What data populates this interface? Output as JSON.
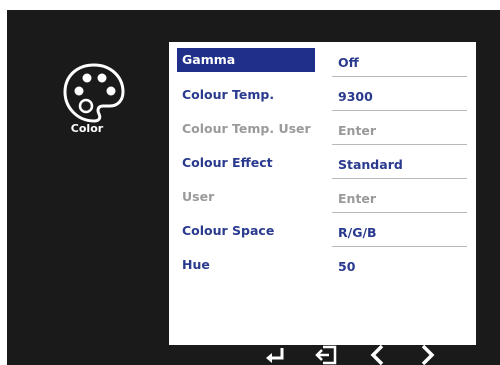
{
  "category": {
    "label": "Color",
    "icon": "palette-icon"
  },
  "menu": {
    "items": [
      {
        "label": "Gamma",
        "value": "Off",
        "state": "selected"
      },
      {
        "label": "Colour Temp.",
        "value": "9300",
        "state": "active"
      },
      {
        "label": "Colour Temp. User",
        "value": "Enter",
        "state": "disabled"
      },
      {
        "label": "Colour Effect",
        "value": "Standard",
        "state": "active"
      },
      {
        "label": "User",
        "value": "Enter",
        "state": "disabled"
      },
      {
        "label": "Colour Space",
        "value": "R/G/B",
        "state": "active"
      },
      {
        "label": "Hue",
        "value": "50",
        "state": "active"
      }
    ]
  },
  "nav": {
    "buttons": [
      "enter-icon",
      "exit-icon",
      "left-arrow-icon",
      "right-arrow-icon"
    ]
  },
  "colors": {
    "osd_background": "#1a1a1a",
    "selection": "#1f2f8a",
    "active_text": "#2a3a8e",
    "disabled_text": "#9a9a9a"
  }
}
